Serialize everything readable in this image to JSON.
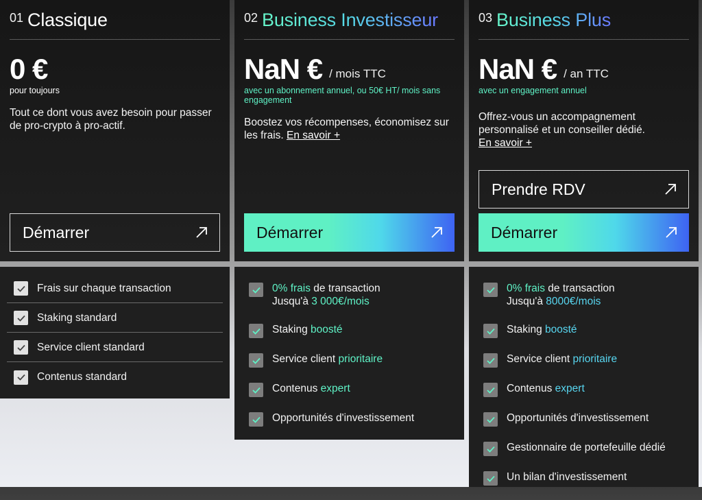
{
  "plans": [
    {
      "number": "01",
      "name": "Classique",
      "price": "0 €",
      "period": "",
      "subnote": "pour toujours",
      "description": "Tout ce dont vous avez besoin pour passer de pro-crypto à pro-actif.",
      "link": "",
      "secondary_button": "",
      "button": "Démarrer",
      "features": [
        {
          "pre": "Frais sur chaque transaction"
        },
        {
          "pre": "Staking standard"
        },
        {
          "pre": "Service client standard"
        },
        {
          "pre": "Contenus standard"
        }
      ]
    },
    {
      "number": "02",
      "name": "Business Investisseur",
      "price": "NaN €",
      "period": "/ mois TTC",
      "subnote": "avec un abonnement annuel, ou 50€ HT/ mois sans engagement",
      "description": "Boostez vos récompenses, économisez sur les frais.",
      "link": "En savoir +",
      "secondary_button": "",
      "button": "Démarrer",
      "features": [
        {
          "hl": "0% frais",
          "post": " de transaction",
          "line2_pre": "Jusqu'à ",
          "line2_hl": "3 000€/mois"
        },
        {
          "pre": "Staking ",
          "hl": "boosté"
        },
        {
          "pre": "Service client ",
          "hl": "prioritaire"
        },
        {
          "pre": "Contenus ",
          "hl": "expert"
        },
        {
          "pre": "Opportunités d'investissement"
        }
      ]
    },
    {
      "number": "03",
      "name": "Business Plus",
      "price": "NaN €",
      "period": "/ an TTC",
      "subnote": "avec un engagement annuel",
      "description": "Offrez-vous un accompagnement personnalisé et un conseiller dédié.",
      "link": "En savoir +",
      "secondary_button": "Prendre RDV",
      "button": "Démarrer",
      "features": [
        {
          "hl": "0% frais",
          "post": " de transaction",
          "line2_pre": "Jusqu'à ",
          "line2_hl": "8000€/mois"
        },
        {
          "pre": "Staking ",
          "hl": "boosté"
        },
        {
          "pre": "Service client ",
          "hl": "prioritaire"
        },
        {
          "pre": "Contenus ",
          "hl": "expert"
        },
        {
          "pre": "Opportunités d'investissement"
        },
        {
          "pre": "Gestionnaire de portefeuille dédié"
        },
        {
          "pre": "Un bilan d'investissement"
        }
      ]
    }
  ],
  "colors": {
    "accent_green": "#5ff2c6",
    "accent_cyan": "#58d6f0",
    "accent_blue": "#3e63f2",
    "card_bg": "#1a1a1a"
  },
  "icons": {
    "arrow": "arrow-up-right-icon",
    "check": "checkbox-check-icon"
  }
}
